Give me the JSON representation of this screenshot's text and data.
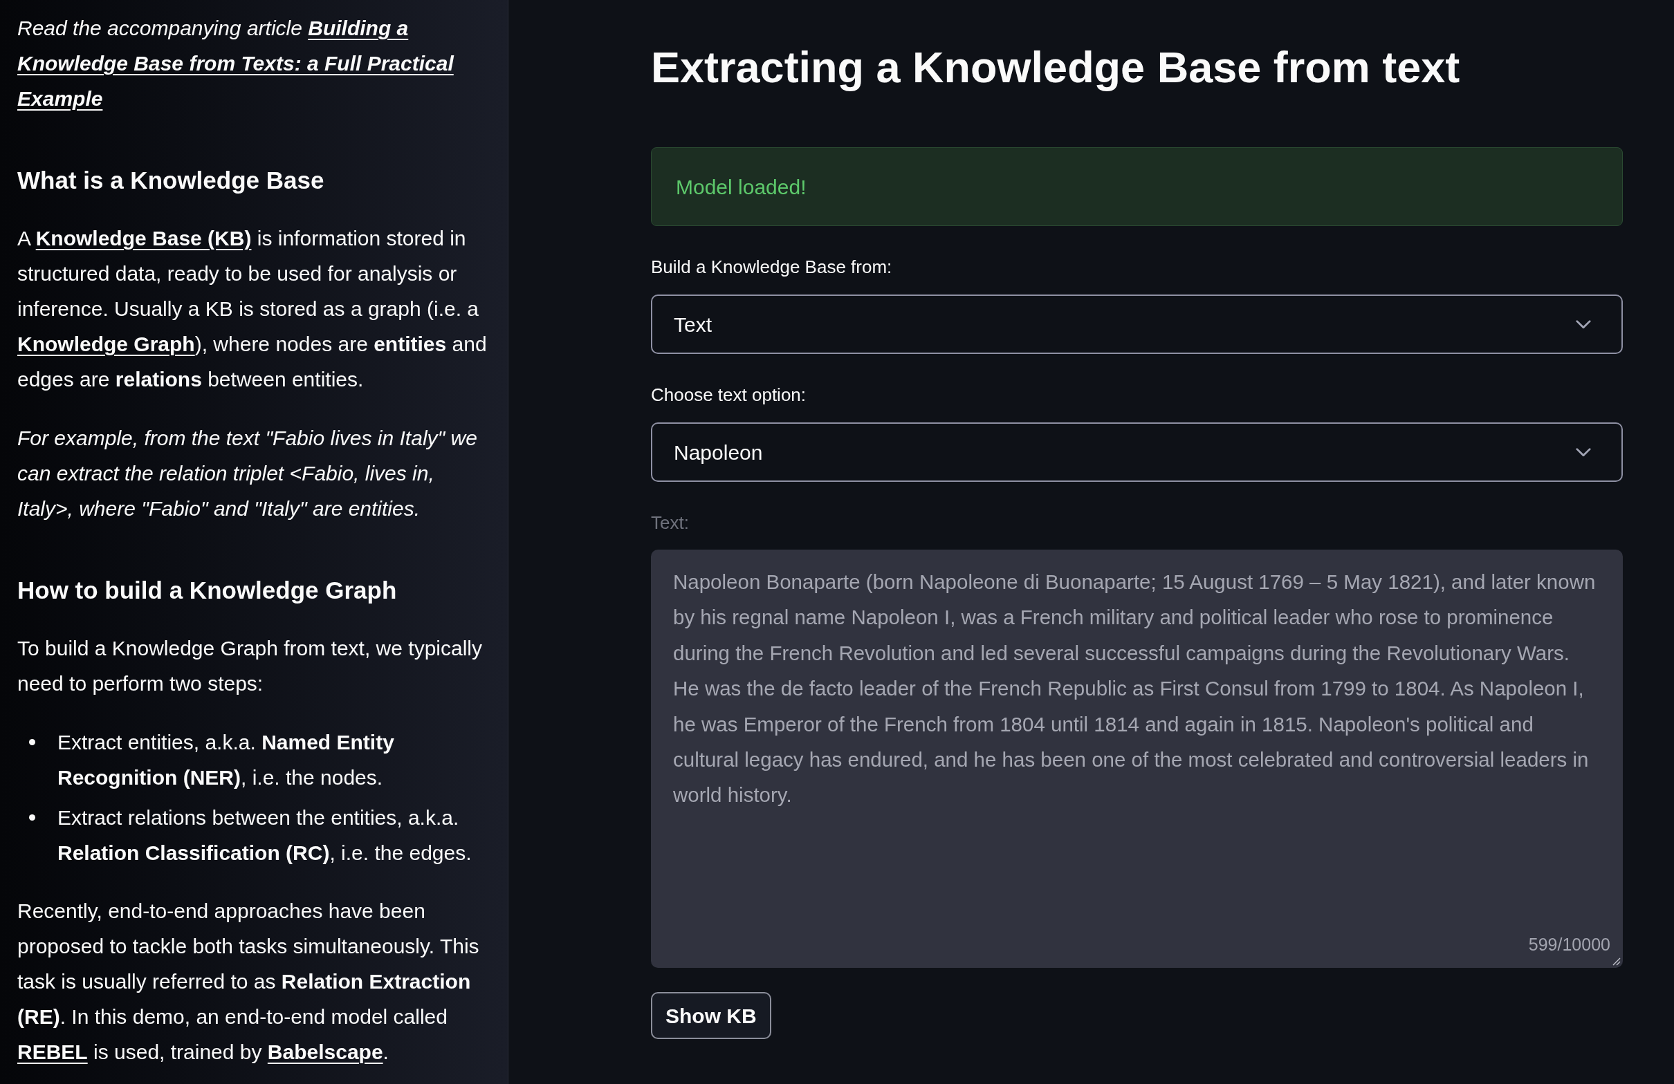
{
  "sidebar": {
    "blocks": [
      {
        "kind": "paragraph",
        "italic": true,
        "runs": [
          {
            "kind": "text",
            "text": "Read the accompanying article "
          },
          {
            "kind": "link",
            "text": "Building a Knowledge Base from Texts: a Full Practical Example"
          }
        ]
      },
      {
        "kind": "heading",
        "text": "What is a Knowledge Base"
      },
      {
        "kind": "paragraph",
        "italic": false,
        "runs": [
          {
            "kind": "text",
            "text": "A "
          },
          {
            "kind": "link",
            "text": "Knowledge Base (KB)"
          },
          {
            "kind": "text",
            "text": " is information stored in structured data, ready to be used for analysis or inference. Usually a KB is stored as a graph (i.e. a "
          },
          {
            "kind": "link",
            "text": "Knowledge Graph"
          },
          {
            "kind": "text",
            "text": "), where nodes are **entities** and edges are **relations** between entities."
          }
        ]
      },
      {
        "kind": "paragraph",
        "italic": true,
        "runs": [
          {
            "kind": "text",
            "text": "For example, from the text \"Fabio lives in Italy\" we can extract the relation triplet <Fabio, lives in, Italy>, where \"Fabio\" and \"Italy\" are entities."
          }
        ]
      },
      {
        "kind": "heading",
        "text": "How to build a Knowledge Graph"
      },
      {
        "kind": "paragraph",
        "italic": false,
        "runs": [
          {
            "kind": "text",
            "text": "To build a Knowledge Graph from text, we typically need to perform two steps:"
          }
        ]
      },
      {
        "kind": "list",
        "items": [
          "Extract entities, a.k.a. **Named Entity Recognition (NER)**, i.e. the nodes.",
          "Extract relations between the entities, a.k.a. **Relation Classification (RC)**, i.e. the edges."
        ]
      },
      {
        "kind": "paragraph",
        "italic": false,
        "runs": [
          {
            "kind": "text",
            "text": "Recently, end-to-end approaches have been proposed to tackle both tasks simultaneously. This task is usually referred to as **Relation Extraction (RE)**. In this demo, an end-to-end model called "
          },
          {
            "kind": "link",
            "text": "REBEL"
          },
          {
            "kind": "text",
            "text": " is used, trained by "
          },
          {
            "kind": "link",
            "text": "Babelscape"
          },
          {
            "kind": "text",
            "text": "."
          }
        ]
      }
    ]
  },
  "main": {
    "title": "Extracting a Knowledge Base from text",
    "alert": {
      "kind": "success",
      "text": "Model loaded!"
    },
    "selects": [
      {
        "label": "Build a Knowledge Base from:",
        "value": "Text"
      },
      {
        "label": "Choose text option:",
        "value": "Napoleon"
      }
    ],
    "text_area": {
      "label": "Text:",
      "disabled": true,
      "value": "Napoleon Bonaparte (born Napoleone di Buonaparte; 15 August 1769 – 5 May 1821), and later known by his regnal name Napoleon I, was a French military and political leader who rose to prominence during the French Revolution and led several successful campaigns during the Revolutionary Wars. He was the de facto leader of the French Republic as First Consul from 1799 to 1804. As Napoleon I, he was Emperor of the French from 1804 until 1814 and again in 1815. Napoleon's political and cultural legacy has endured, and he has been one of the most celebrated and controversial leaders in world history.",
      "counter": "599/10000"
    },
    "button": {
      "label": "Show KB"
    }
  }
}
